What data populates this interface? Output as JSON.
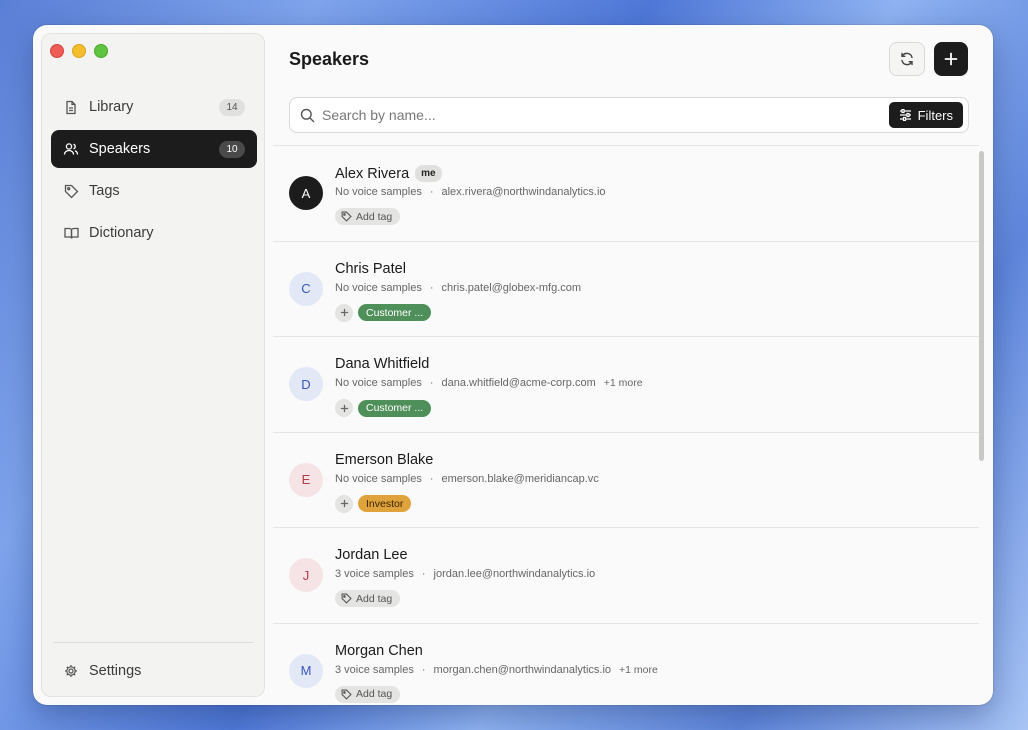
{
  "sidebar": {
    "items": [
      {
        "label": "Library",
        "count": "14"
      },
      {
        "label": "Speakers",
        "count": "10"
      },
      {
        "label": "Tags"
      },
      {
        "label": "Dictionary"
      }
    ],
    "settings_label": "Settings"
  },
  "header": {
    "title": "Speakers"
  },
  "search": {
    "placeholder": "Search by name...",
    "filters_label": "Filters"
  },
  "speakers": [
    {
      "initial": "A",
      "name": "Alex Rivera",
      "badge": "me",
      "samples": "No voice samples",
      "email": "alex.rivera@northwindanalytics.io",
      "add_tag": "Add tag"
    },
    {
      "initial": "C",
      "name": "Chris Patel",
      "samples": "No voice samples",
      "email": "chris.patel@globex-mfg.com",
      "tag": "Customer ..."
    },
    {
      "initial": "D",
      "name": "Dana Whitfield",
      "samples": "No voice samples",
      "email": "dana.whitfield@acme-corp.com",
      "more": "+1 more",
      "tag": "Customer ..."
    },
    {
      "initial": "E",
      "name": "Emerson Blake",
      "samples": "No voice samples",
      "email": "emerson.blake@meridiancap.vc",
      "tag": "Investor"
    },
    {
      "initial": "J",
      "name": "Jordan Lee",
      "samples": "3 voice samples",
      "email": "jordan.lee@northwindanalytics.io",
      "add_tag": "Add tag"
    },
    {
      "initial": "M",
      "name": "Morgan Chen",
      "samples": "3 voice samples",
      "email": "morgan.chen@northwindanalytics.io",
      "more": "+1 more",
      "add_tag": "Add tag"
    }
  ],
  "colors": {
    "accent_dark": "#1c1c1c",
    "tag_customer": "#4f8f5a",
    "tag_investor": "#e0a23b"
  }
}
